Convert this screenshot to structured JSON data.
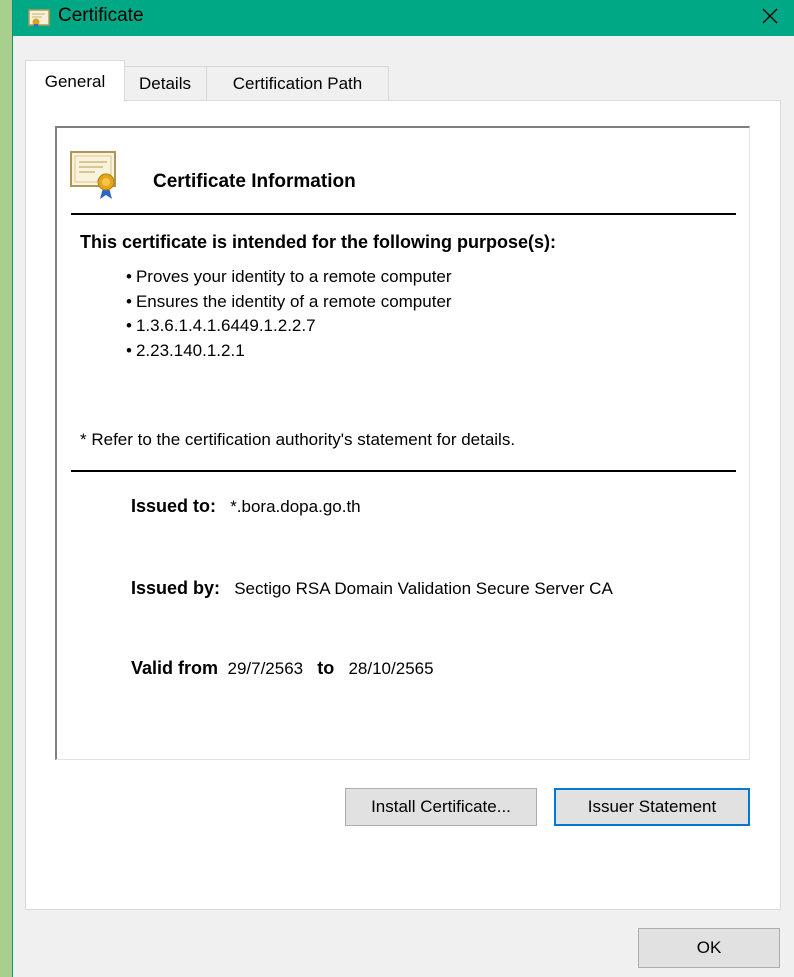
{
  "window": {
    "title": "Certificate",
    "close_glyph": "✕",
    "icon": "certificate-icon"
  },
  "tabs": [
    {
      "label": "General",
      "active": true
    },
    {
      "label": "Details",
      "active": false
    },
    {
      "label": "Certification Path",
      "active": false
    }
  ],
  "general": {
    "header": "Certificate Information",
    "purpose_heading": "This certificate is intended for the following purpose(s):",
    "purposes": [
      "Proves your identity to a remote computer",
      "Ensures the identity of a remote computer",
      "1.3.6.1.4.1.6449.1.2.2.7",
      "2.23.140.1.2.1"
    ],
    "refer_note": "* Refer to the certification authority's statement for details.",
    "issued_to_label": "Issued to:",
    "issued_to_value": "*.bora.dopa.go.th",
    "issued_by_label": "Issued by:",
    "issued_by_value": "Sectigo RSA Domain Validation Secure Server CA",
    "valid_from_label": "Valid from",
    "valid_from_value": "29/7/2563",
    "valid_to_label": "to",
    "valid_to_value": "28/10/2565"
  },
  "buttons": {
    "install": "Install Certificate...",
    "issuer_statement": "Issuer Statement",
    "ok": "OK"
  },
  "colors": {
    "titlebar": "#00a885",
    "focus_border": "#0078d7",
    "window_bg": "#f0f0f0"
  }
}
